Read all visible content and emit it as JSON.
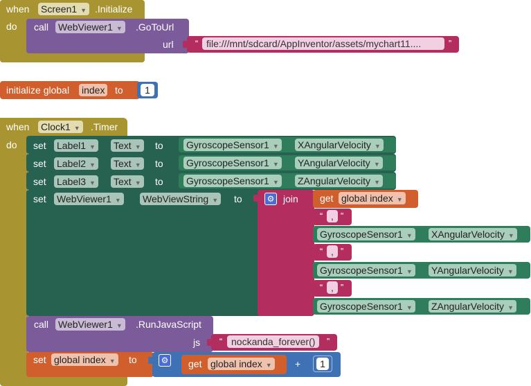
{
  "colors": {
    "event": "#a89532",
    "webviewer": "#7b5b99",
    "text": "#b32d5e",
    "variable": "#d05f2d",
    "math": "#3f71b5",
    "sensor": "#2f7d5b",
    "label": "#276150"
  },
  "event1": {
    "when": "when",
    "do": "do",
    "component": "Screen1",
    "event": ".Initialize",
    "call": "call",
    "target": "WebViewer1",
    "method": ".GoToUrl",
    "param": "url",
    "url_value": "file:///mnt/sdcard/AppInventor/assets/mychart11...."
  },
  "global_init": {
    "label": "initialize global",
    "name": "index",
    "to": "to",
    "value": "1"
  },
  "event2": {
    "when": "when",
    "do": "do",
    "component": "Clock1",
    "event": ".Timer",
    "sets": [
      {
        "set": "set",
        "component": "Label1",
        "prop": "Text",
        "to": "to",
        "sensor": "GyroscopeSensor1",
        "sensor_prop": "XAngularVelocity"
      },
      {
        "set": "set",
        "component": "Label2",
        "prop": "Text",
        "to": "to",
        "sensor": "GyroscopeSensor1",
        "sensor_prop": "YAngularVelocity"
      },
      {
        "set": "set",
        "component": "Label3",
        "prop": "Text",
        "to": "to",
        "sensor": "GyroscopeSensor1",
        "sensor_prop": "ZAngularVelocity"
      }
    ],
    "webview_set": {
      "set": "set",
      "component": "WebViewer1",
      "prop": "WebViewString",
      "to": "to",
      "join": "join",
      "get": "get",
      "get_var": "global index",
      "sep1": ",",
      "sensor1": "GyroscopeSensor1",
      "sensor1_prop": "XAngularVelocity",
      "sep2": ",",
      "sensor2": "GyroscopeSensor1",
      "sensor2_prop": "YAngularVelocity",
      "sep3": ",",
      "sensor3": "GyroscopeSensor1",
      "sensor3_prop": "ZAngularVelocity"
    },
    "run_js": {
      "call": "call",
      "component": "WebViewer1",
      "method": ".RunJavaScript",
      "param": "js",
      "value": "nockanda_forever()"
    },
    "increment": {
      "set": "set",
      "var": "global index",
      "to": "to",
      "get": "get",
      "get_var": "global index",
      "op": "+",
      "amount": "1"
    }
  },
  "icons": {
    "dropdown": "dropdown-arrow-icon",
    "mutator": "gear-mutator-icon",
    "quote": "quote-icon"
  }
}
